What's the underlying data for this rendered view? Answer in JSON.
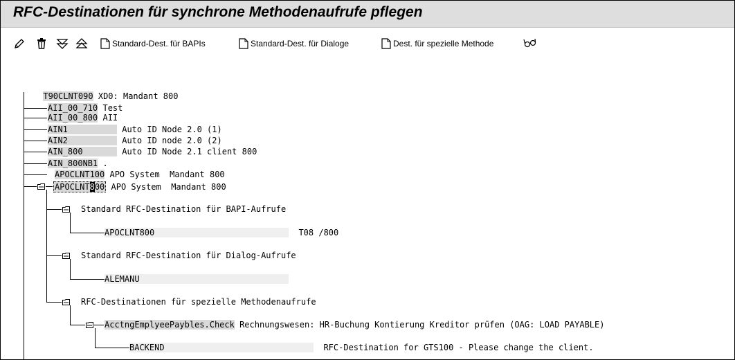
{
  "window": {
    "title": "RFC-Destinationen für synchrone Methodenaufrufe pflegen"
  },
  "toolbar": {
    "btn_standard_bapi": "Standard-Dest. für BAPIs",
    "btn_standard_dialog": "Standard-Dest. für Dialoge",
    "btn_special_method": "Dest. für spezielle Methode"
  },
  "tree": {
    "root_key": "T90CLNT090",
    "root_text": "XD0: Mandant 800",
    "items": [
      {
        "key": "AII_00_710",
        "text": "Test"
      },
      {
        "key": "AII_00_800",
        "text": "AII"
      },
      {
        "key": "AIN1",
        "text": "Auto ID Node 2.0 (1)"
      },
      {
        "key": "AIN2",
        "text": "Auto ID node 2.0 (2)"
      },
      {
        "key": "AIN_800",
        "text": "Auto ID Node 2.1 client 800"
      },
      {
        "key": "AIN_800NB1",
        "text": "."
      },
      {
        "key": "APOCLNT100",
        "text": "APO System  Mandant 800"
      }
    ],
    "selected": {
      "key_a": "APOCLNT",
      "key_cursor": "8",
      "key_b": "00",
      "text": "APO System  Mandant 800"
    },
    "bapi_folder": "Standard RFC-Destination für BAPI-Aufrufe",
    "bapi_dest": "APOCLNT800",
    "bapi_dest_desc": "T08 /800",
    "dialog_folder": "Standard RFC-Destination für Dialog-Aufrufe",
    "dialog_dest": "ALEMANU",
    "method_folder": "RFC-Destinationen für spezielle Methodenaufrufe",
    "method_key": "AcctngEmplyeePaybles.Check",
    "method_text": "Rechnungswesen: HR-Buchung Kontierung Kreditor prüfen (OAG: LOAD PAYABLE)",
    "method_dest": "BACKEND",
    "method_dest_desc": "RFC-Destination for GTS100 - Please change the client."
  }
}
